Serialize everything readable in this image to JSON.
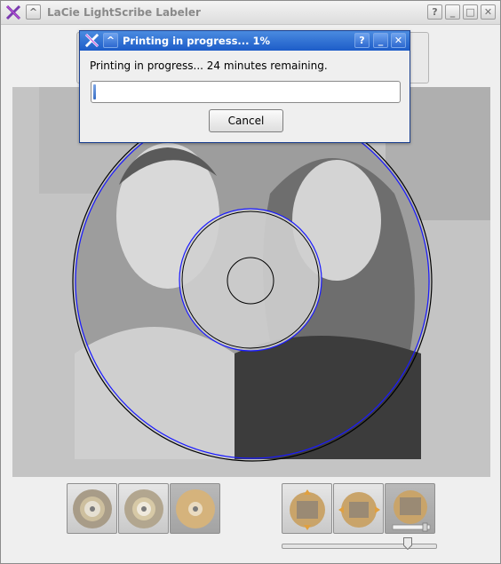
{
  "main_window": {
    "title": "LaCie LightScribe Labeler",
    "titlebar_buttons": {
      "help": "?",
      "minimize": "_",
      "maximize": "□",
      "close": "✕"
    },
    "shade": "^"
  },
  "dialog": {
    "title": "Printing in progress... 1%",
    "message": "Printing in progress... 24 minutes remaining.",
    "progress_percent": 1,
    "cancel_label": "Cancel",
    "titlebar_buttons": {
      "help": "?",
      "minimize": "_",
      "close": "✕"
    },
    "shade": "^"
  },
  "label_modes": [
    {
      "name": "title-only-mode"
    },
    {
      "name": "content-mode"
    },
    {
      "name": "full-disc-mode",
      "active": true
    }
  ],
  "image_position_buttons": [
    {
      "name": "move-image"
    },
    {
      "name": "resize-image"
    },
    {
      "name": "zoom-image"
    }
  ],
  "zoom_slider": {
    "value_fraction": 0.82
  },
  "colors": {
    "dialog_title": "#1d5cc8",
    "disc_outline": "#1a1aff",
    "accent": "#3a6fc4"
  }
}
